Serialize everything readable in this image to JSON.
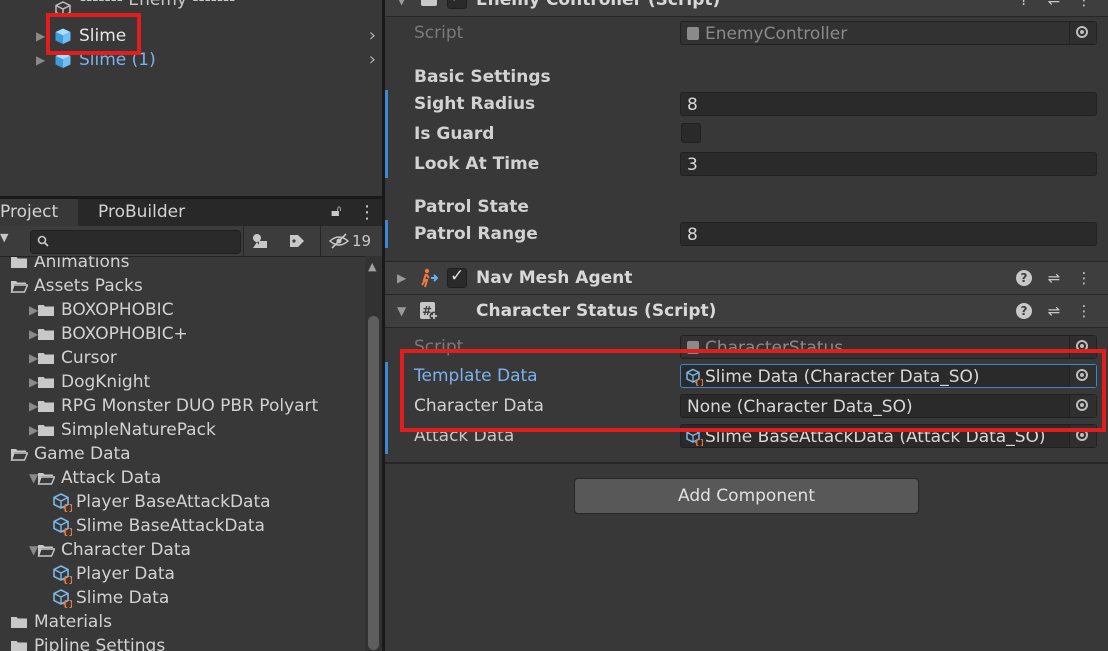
{
  "hierarchy": {
    "items": [
      {
        "label": "------- Enemy -------",
        "selected": false,
        "prefab": false
      },
      {
        "label": "Slime",
        "selected": true,
        "prefab": true
      },
      {
        "label": "Slime (1)",
        "selected": false,
        "prefab": true
      }
    ]
  },
  "project": {
    "tabs": [
      {
        "label": "Project",
        "active": true
      },
      {
        "label": "ProBuilder",
        "active": false
      }
    ],
    "toolbar": {
      "hidden_count": "19"
    },
    "tree": [
      {
        "label": "Animations",
        "type": "folder",
        "indent": 0,
        "expand": "none"
      },
      {
        "label": "Assets Packs",
        "type": "folder-open",
        "indent": 0,
        "expand": "none"
      },
      {
        "label": "BOXOPHOBIC",
        "type": "folder",
        "indent": 1,
        "expand": "collapsed"
      },
      {
        "label": "BOXOPHOBIC+",
        "type": "folder",
        "indent": 1,
        "expand": "collapsed"
      },
      {
        "label": "Cursor",
        "type": "folder",
        "indent": 1,
        "expand": "collapsed"
      },
      {
        "label": "DogKnight",
        "type": "folder",
        "indent": 1,
        "expand": "collapsed"
      },
      {
        "label": "RPG Monster DUO PBR Polyart",
        "type": "folder",
        "indent": 1,
        "expand": "collapsed"
      },
      {
        "label": "SimpleNaturePack",
        "type": "folder",
        "indent": 1,
        "expand": "collapsed"
      },
      {
        "label": "Game Data",
        "type": "folder-open",
        "indent": 0,
        "expand": "none"
      },
      {
        "label": "Attack Data",
        "type": "folder-open",
        "indent": 1,
        "expand": "expanded"
      },
      {
        "label": "Player BaseAttackData",
        "type": "asset",
        "indent": 2,
        "expand": "none"
      },
      {
        "label": "Slime BaseAttackData",
        "type": "asset",
        "indent": 2,
        "expand": "none"
      },
      {
        "label": "Character Data",
        "type": "folder-open",
        "indent": 1,
        "expand": "expanded"
      },
      {
        "label": "Player Data",
        "type": "asset",
        "indent": 2,
        "expand": "none"
      },
      {
        "label": "Slime Data",
        "type": "asset",
        "indent": 2,
        "expand": "none"
      },
      {
        "label": "Materials",
        "type": "folder",
        "indent": 0,
        "expand": "none"
      },
      {
        "label": "Pipline Settings",
        "type": "folder",
        "indent": 0,
        "expand": "none"
      }
    ]
  },
  "inspector": {
    "enemy_controller": {
      "title": "Enemy Controller (Script)",
      "script_label": "Script",
      "script_value": "EnemyController",
      "basic_settings": "Basic Settings",
      "sight_radius_label": "Sight Radius",
      "sight_radius": "8",
      "is_guard_label": "Is Guard",
      "is_guard": false,
      "look_at_time_label": "Look At Time",
      "look_at_time": "3",
      "patrol_state": "Patrol State",
      "patrol_range_label": "Patrol Range",
      "patrol_range": "8"
    },
    "nav_mesh_agent": {
      "title": "Nav Mesh Agent",
      "enabled": true
    },
    "character_status": {
      "title": "Character Status (Script)",
      "script_label": "Script",
      "script_value": "CharacterStatus",
      "template_data_label": "Template Data",
      "template_data": "Slime Data (Character Data_SO)",
      "character_data_label": "Character Data",
      "character_data": "None (Character Data_SO)",
      "attack_data_label": "Attack Data",
      "attack_data": "Slime BaseAttackData (Attack Data_SO)"
    },
    "add_component": "Add Component"
  },
  "colors": {
    "highlight": "#e21d1d",
    "accent_blue": "#7bb2f0",
    "prefab_blue": "#5fb3f0"
  }
}
